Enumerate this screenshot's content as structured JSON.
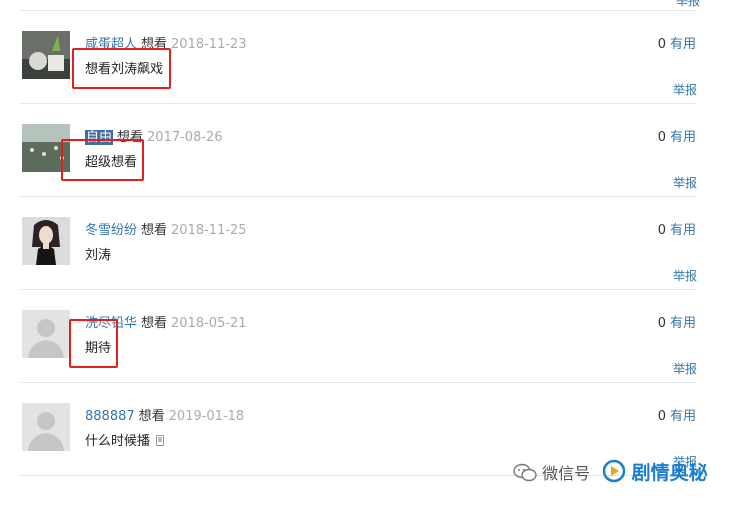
{
  "top": {
    "report_label": "举报"
  },
  "comments": [
    {
      "user": "咸蛋超人",
      "status": "想看",
      "date": "2018-11-23",
      "text": "想看刘涛飙戏",
      "votes": "0",
      "useful": "有用",
      "report": "举报",
      "avatar_icon": "photo-avatar"
    },
    {
      "user": "自由",
      "status": "想看",
      "date": "2017-08-26",
      "text": "超级想看",
      "votes": "0",
      "useful": "有用",
      "report": "举报",
      "avatar_icon": "photo-avatar"
    },
    {
      "user": "冬雪纷纷",
      "status": "想看",
      "date": "2018-11-25",
      "text": "刘涛",
      "votes": "0",
      "useful": "有用",
      "report": "举报",
      "avatar_icon": "photo-avatar"
    },
    {
      "user": "洗尽铅华",
      "status": "想看",
      "date": "2018-05-21",
      "text": "期待",
      "votes": "0",
      "useful": "有用",
      "report": "举报",
      "avatar_icon": "default-user-avatar"
    },
    {
      "user": "888887",
      "status": "想看",
      "date": "2019-01-18",
      "text": "什么时候播",
      "votes": "0",
      "useful": "有用",
      "report": "举报",
      "avatar_icon": "default-user-avatar"
    }
  ],
  "watermark": {
    "wechat": "微信号",
    "brand": "剧情奥秘"
  },
  "colors": {
    "link": "#3377aa",
    "highlight": "#e02020",
    "brand": "#1a7fd0"
  }
}
